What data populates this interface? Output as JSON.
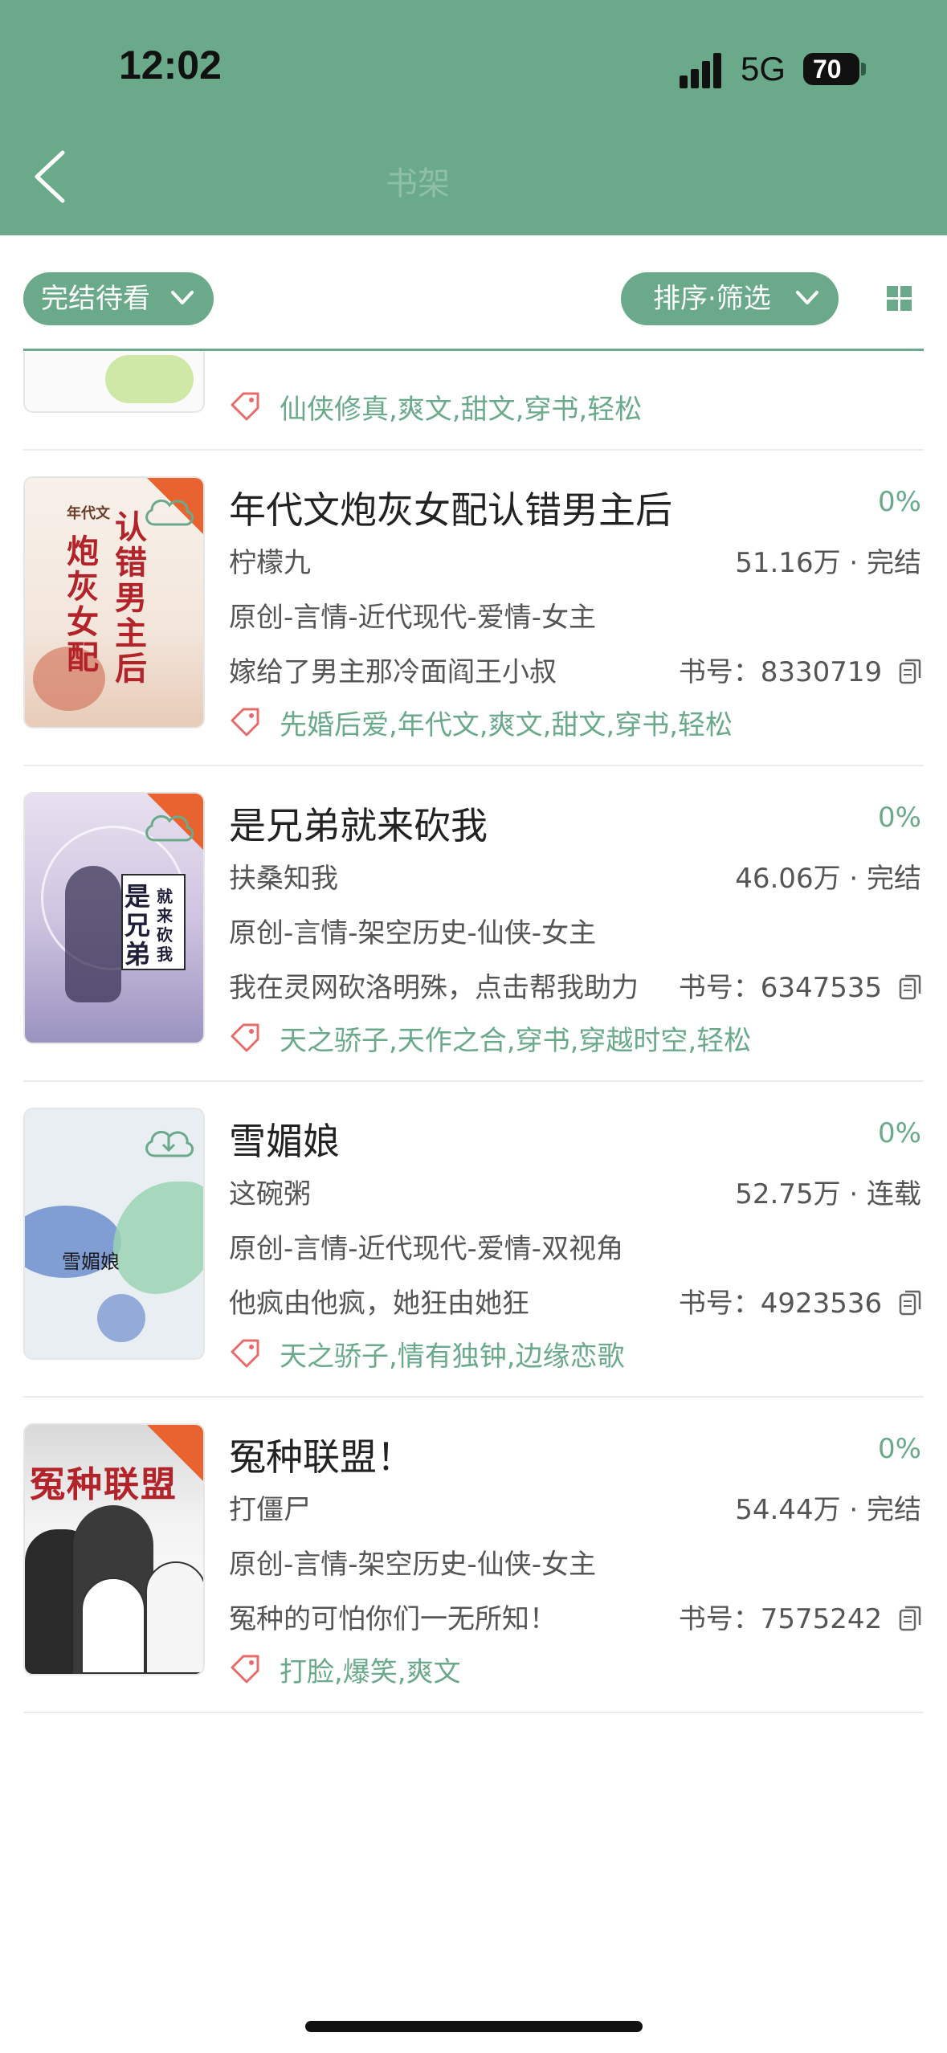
{
  "status_bar": {
    "time": "12:02",
    "network": "5G",
    "battery": "70"
  },
  "header": {
    "title": "书架"
  },
  "filters": {
    "status_label": "完结待看",
    "sort_label": "排序·筛选"
  },
  "partial_book": {
    "tags": "仙侠修真,爽文,甜文,穿书,轻松"
  },
  "books": [
    {
      "title": "年代文炮灰女配认错男主后",
      "progress": "0%",
      "author": "柠檬九",
      "words_status": "51.16万 · 完结",
      "category": "原创-言情-近代现代-爱情-女主",
      "intro": "嫁给了男主那冷面阎王小叔",
      "book_no": "书号：8330719",
      "tags": "先婚后爱,年代文,爽文,甜文,穿书,轻松",
      "cover_text": "年代文 炮灰女配 认错男主后"
    },
    {
      "title": "是兄弟就来砍我",
      "progress": "0%",
      "author": "扶桑知我",
      "words_status": "46.06万 · 完结",
      "category": "原创-言情-架空历史-仙侠-女主",
      "intro": "我在灵网砍洛明殊，点击帮我助力",
      "book_no": "书号：6347535",
      "tags": "天之骄子,天作之合,穿书,穿越时空,轻松",
      "cover_text": "是兄弟 就来砍我"
    },
    {
      "title": "雪媚娘",
      "progress": "0%",
      "author": "这碗粥",
      "words_status": "52.75万 · 连载",
      "category": "原创-言情-近代现代-爱情-双视角",
      "intro": "他疯由他疯，她狂由她狂",
      "book_no": "书号：4923536",
      "tags": "天之骄子,情有独钟,边缘恋歌",
      "cover_text": "雪媚娘"
    },
    {
      "title": "冤种联盟！",
      "progress": "0%",
      "author": "打僵尸",
      "words_status": "54.44万 · 完结",
      "category": "原创-言情-架空历史-仙侠-女主",
      "intro": "冤种的可怕你们一无所知！",
      "book_no": "书号：7575242",
      "tags": "打脸,爆笑,爽文",
      "cover_text": "冤种联盟"
    }
  ],
  "colors": {
    "accent": "#6aaa8a",
    "badge": "#e8632f"
  }
}
